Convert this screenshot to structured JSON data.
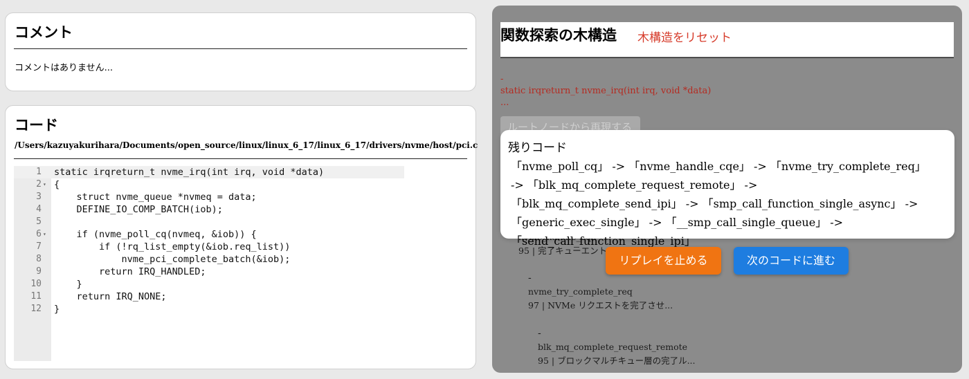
{
  "comments": {
    "title": "コメント",
    "empty_text": "コメントはありません..."
  },
  "code": {
    "title": "コード",
    "file_path": "/Users/kazuyakurihara/Documents/open_source/linux/linux_6_17/linux_6_17/drivers/nvme/host/pci.c",
    "lines": [
      {
        "n": "1",
        "fold": "",
        "text": "static irqreturn_t nvme_irq(int irq, void *data)"
      },
      {
        "n": "2",
        "fold": "▾",
        "text": "{"
      },
      {
        "n": "3",
        "fold": "",
        "text": "    struct nvme_queue *nvmeq = data;"
      },
      {
        "n": "4",
        "fold": "",
        "text": "    DEFINE_IO_COMP_BATCH(iob);"
      },
      {
        "n": "5",
        "fold": "",
        "text": ""
      },
      {
        "n": "6",
        "fold": "▾",
        "text": "    if (nvme_poll_cq(nvmeq, &iob)) {"
      },
      {
        "n": "7",
        "fold": "",
        "text": "        if (!rq_list_empty(&iob.req_list))"
      },
      {
        "n": "8",
        "fold": "",
        "text": "            nvme_pci_complete_batch(&iob);"
      },
      {
        "n": "9",
        "fold": "",
        "text": "        return IRQ_HANDLED;"
      },
      {
        "n": "10",
        "fold": "",
        "text": "    }"
      },
      {
        "n": "11",
        "fold": "",
        "text": "    return IRQ_NONE;"
      },
      {
        "n": "12",
        "fold": "",
        "text": "}"
      }
    ]
  },
  "tree": {
    "title": "関数探索の木構造",
    "reset_label": "木構造をリセット",
    "root": {
      "dash": "-",
      "signature": "static irqreturn_t nvme_irq(int irq, void *data)",
      "ellipsis": "..."
    },
    "replay_from_root_label": "ルートノードから再現する",
    "partial_node": {
      "name": "nvme_handle_cqe",
      "desc": "95 | 完了キューエント"
    },
    "nodes": [
      {
        "dash": "-",
        "name": "nvme_try_complete_req",
        "desc": "97 | NVMe リクエストを完了させ..."
      },
      {
        "dash": "-",
        "name": "blk_mq_complete_request_remote",
        "desc": "95 | ブロックマルチキュー層の完了ル..."
      }
    ]
  },
  "remaining_code": {
    "label": "残りコード",
    "chain": "「nvme_poll_cq」 -> 「nvme_handle_cqe」 -> 「nvme_try_complete_req」 -> 「blk_mq_complete_request_remote」 -> 「blk_mq_complete_send_ipi」 -> 「smp_call_function_single_async」 -> 「generic_exec_single」 -> 「__smp_call_single_queue」 -> 「send_call_function_single_ipi」"
  },
  "actions": {
    "stop_replay_label": "リプレイを止める",
    "next_code_label": "次のコードに進む"
  }
}
